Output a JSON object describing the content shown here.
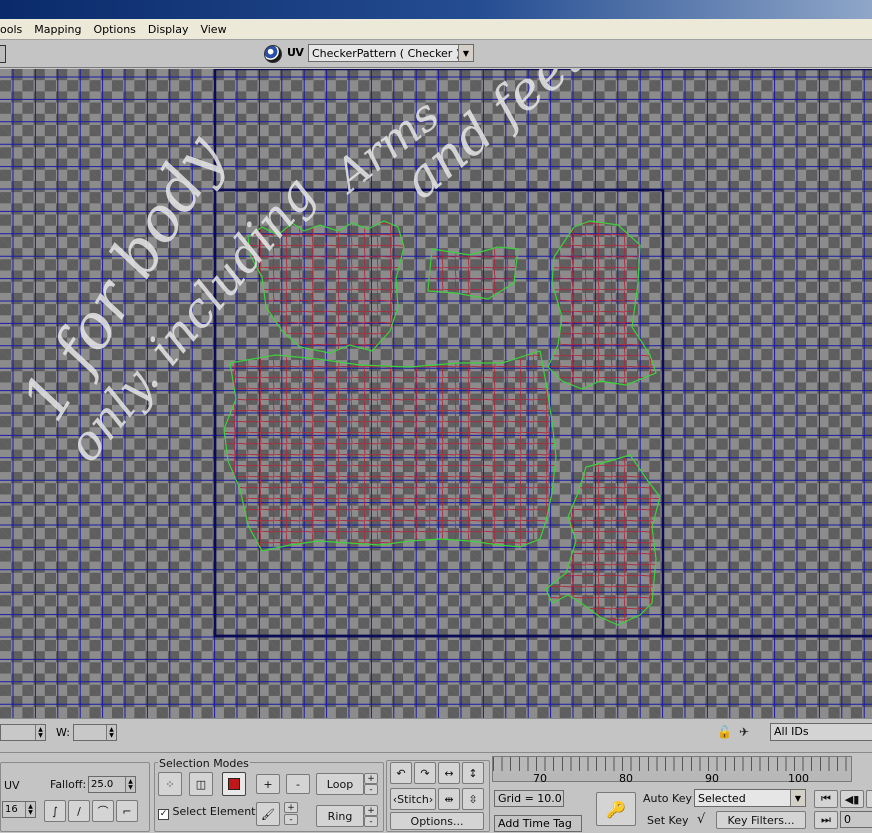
{
  "menu": [
    "ools",
    "Mapping",
    "Options",
    "Display",
    "View"
  ],
  "toolbar": {
    "uv_label": "UV",
    "texture_select": "CheckerPattern  ( Checker )"
  },
  "handwriting": {
    "line1": "1 for body",
    "line2": "only. including",
    "line3": "Arms",
    "line4": "and feet"
  },
  "status": {
    "w_label": "W:",
    "ids_select": "All IDs"
  },
  "panel": {
    "uv_label": "UV",
    "falloff_label": "Falloff:",
    "falloff_value": "25.0",
    "size_value": "16",
    "selection_modes_title": "Selection Modes",
    "select_element_label": "Select Element",
    "loop_label": "Loop",
    "ring_label": "Ring",
    "plus": "+",
    "minus": "-",
    "stitch_label": "Stitch",
    "options_label": "Options...",
    "grid_label": "Grid = 10.0",
    "add_time_tag": "Add Time Tag",
    "auto_key": "Auto Key",
    "set_key": "Set Key",
    "key_select": "Selected",
    "key_filters": "Key Filters...",
    "frame_value": "0"
  },
  "timeline": {
    "ticks": [
      "70",
      "80",
      "90",
      "100"
    ]
  },
  "colors": {
    "grid": "#1a1aa8",
    "border": "#0c0c55",
    "mesh": "#b0283c",
    "seam": "#3cd23c",
    "writing": "#e8e8e8"
  }
}
